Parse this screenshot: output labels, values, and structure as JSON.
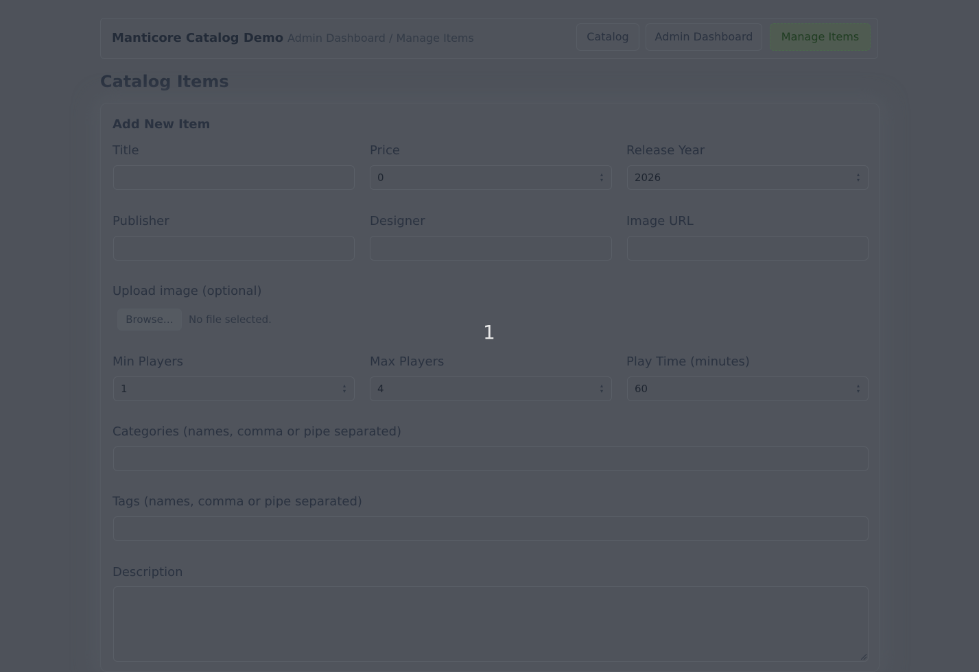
{
  "header": {
    "brand": "Manticore Catalog Demo",
    "breadcrumb": "Admin Dashboard / Manage Items",
    "nav": [
      {
        "label": "Catalog"
      },
      {
        "label": "Admin Dashboard"
      },
      {
        "label": "Manage Items",
        "active": true
      }
    ]
  },
  "page_title": "Catalog Items",
  "form": {
    "title": "Add New Item",
    "fields": {
      "title": {
        "label": "Title",
        "value": ""
      },
      "price": {
        "label": "Price",
        "value": "0"
      },
      "release_year": {
        "label": "Release Year",
        "value": "2026"
      },
      "publisher": {
        "label": "Publisher",
        "value": ""
      },
      "designer": {
        "label": "Designer",
        "value": ""
      },
      "image_url": {
        "label": "Image URL",
        "value": ""
      },
      "upload": {
        "label": "Upload image (optional)",
        "button": "Browse…",
        "status": "No file selected."
      },
      "min_players": {
        "label": "Min Players",
        "value": "1"
      },
      "max_players": {
        "label": "Max Players",
        "value": "4"
      },
      "play_time": {
        "label": "Play Time (minutes)",
        "value": "60"
      },
      "categories": {
        "label": "Categories (names, comma or pipe separated)",
        "value": ""
      },
      "tags": {
        "label": "Tags (names, comma or pipe separated)",
        "value": ""
      },
      "description": {
        "label": "Description",
        "value": ""
      }
    }
  },
  "overlay_marker": "1",
  "colors": {
    "active_nav_text": "#203d22",
    "overlay_text": "#e8e8e8",
    "page_bg": "#4e525a"
  }
}
